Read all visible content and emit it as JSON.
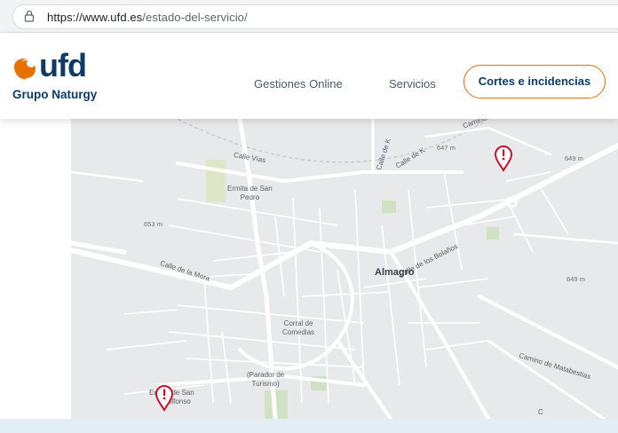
{
  "browser": {
    "url_host": "https://www.ufd.es",
    "url_path": "/estado-del-servicio/"
  },
  "header": {
    "logo_word": "ufd",
    "logo_sub": "Grupo Naturgy",
    "nav": {
      "gestiones": "Gestiones Online",
      "servicios": "Servicios",
      "cortes": "Cortes e incidencias"
    }
  },
  "colors": {
    "brand_navy": "#0d3b66",
    "brand_orange": "#e57200",
    "pin_red": "#c8102e"
  },
  "map": {
    "labels": {
      "calle_vias": "Calle Vías",
      "ermita_pedro_1": "Ermita de San",
      "ermita_pedro_2": "Pedro",
      "calle_mora": "Calle de la Mora",
      "calle_bolanos": "Calle de los Bolaños",
      "almagro": "Almagro",
      "corral_1": "Corral de",
      "corral_2": "Comedias",
      "parador_1": "(Parador de",
      "parador_2": "Turismo)",
      "ermita_alfonso_1": "Ermita de San",
      "ermita_alfonso_2": "Alfonso",
      "calle_k1": "Calle de K",
      "calle_k2": "Calle de K",
      "camino": "Camino",
      "camino_matabestias": "Camino de Matabestias",
      "elev_647": "647 m",
      "elev_649a": "649 m",
      "elev_653": "653 m",
      "elev_649b": "649 m",
      "side_c": "C"
    },
    "pins": [
      "alert-pin",
      "alert-pin"
    ]
  }
}
